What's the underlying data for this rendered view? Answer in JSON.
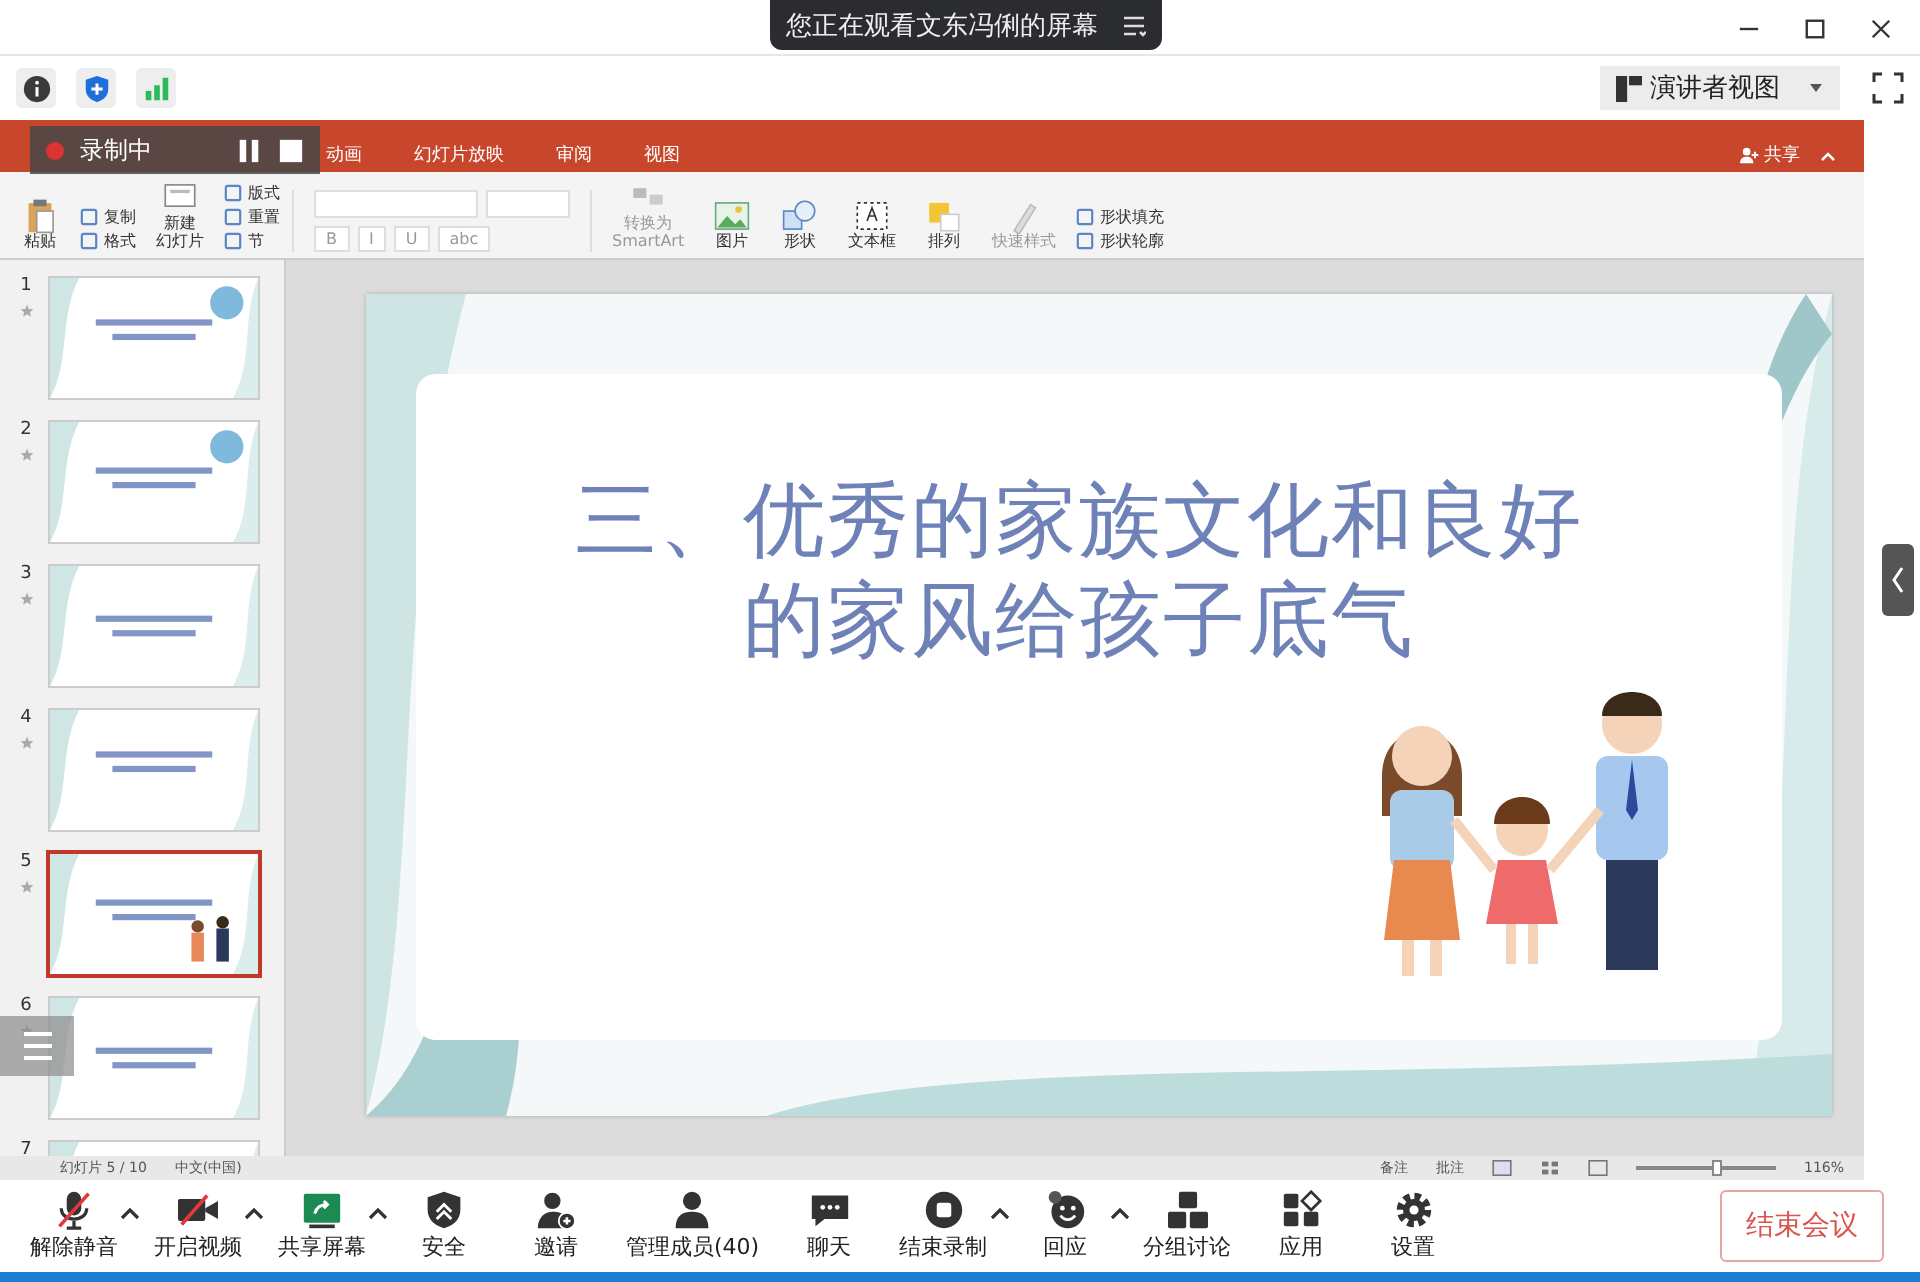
{
  "share_banner": {
    "text": "您正在观看文东冯俐的屏幕"
  },
  "view_button": {
    "label": "演讲者视图"
  },
  "recording": {
    "label": "录制中"
  },
  "ppt": {
    "tabs": [
      {
        "label": "动画"
      },
      {
        "label": "幻灯片放映"
      },
      {
        "label": "审阅"
      },
      {
        "label": "视图"
      }
    ],
    "share_label": "共享",
    "ribbon": [
      {
        "kind": "paste",
        "lines": [
          "粘贴"
        ]
      },
      {
        "kind": "stack",
        "items": [
          "复制",
          "格式"
        ]
      },
      {
        "kind": "new_slide",
        "lines": [
          "新建",
          "幻灯片"
        ]
      },
      {
        "kind": "stack",
        "items": [
          "版式",
          "重置",
          "节"
        ]
      },
      {
        "kind": "format",
        "items": [
          "B",
          "I",
          "U",
          "abc"
        ]
      },
      {
        "kind": "smartart",
        "lines": [
          "转换为",
          "SmartArt"
        ]
      },
      {
        "kind": "picture",
        "lines": [
          "图片"
        ]
      },
      {
        "kind": "shape",
        "lines": [
          "形状"
        ]
      },
      {
        "kind": "textbox",
        "lines": [
          "文本框"
        ]
      },
      {
        "kind": "arrange",
        "lines": [
          "排列"
        ]
      },
      {
        "kind": "style",
        "lines": [
          "快速样式"
        ]
      },
      {
        "kind": "stack",
        "items": [
          "形状填充",
          "形状轮廓"
        ]
      }
    ],
    "thumbnails": [
      {
        "number": "1",
        "selected": false
      },
      {
        "number": "2",
        "selected": false
      },
      {
        "number": "3",
        "selected": false
      },
      {
        "number": "4",
        "selected": false
      },
      {
        "number": "5",
        "selected": true
      },
      {
        "number": "6",
        "selected": false
      },
      {
        "number": "7",
        "selected": false
      }
    ],
    "slide": {
      "title_lines": [
        "三、优秀的家族文化和良好",
        "的家风给孩子底气"
      ]
    },
    "status": {
      "slide_info": "幻灯片 5 / 10",
      "language": "中文(中国)",
      "notes": "备注",
      "comments": "批注",
      "zoom": "116%",
      "zoom_slider": {
        "level": 0.55
      }
    }
  },
  "toolbar": [
    {
      "kind": "mic",
      "label": "解除静音",
      "has_menu": true
    },
    {
      "kind": "video",
      "label": "开启视频",
      "has_menu": true
    },
    {
      "kind": "share",
      "label": "共享屏幕",
      "has_menu": true
    },
    {
      "kind": "security",
      "label": "安全",
      "has_menu": false
    },
    {
      "kind": "invite",
      "label": "邀请",
      "has_menu": false
    },
    {
      "kind": "members",
      "label": "管理成员(40)",
      "has_menu": false
    },
    {
      "kind": "chat",
      "label": "聊天",
      "has_menu": false
    },
    {
      "kind": "record",
      "label": "结束录制",
      "has_menu": true
    },
    {
      "kind": "react",
      "label": "回应",
      "has_menu": true
    },
    {
      "kind": "groups",
      "label": "分组讨论",
      "has_menu": false
    },
    {
      "kind": "apps",
      "label": "应用",
      "has_menu": false
    },
    {
      "kind": "settings",
      "label": "设置",
      "has_menu": false
    }
  ],
  "end_button": "结束会议"
}
